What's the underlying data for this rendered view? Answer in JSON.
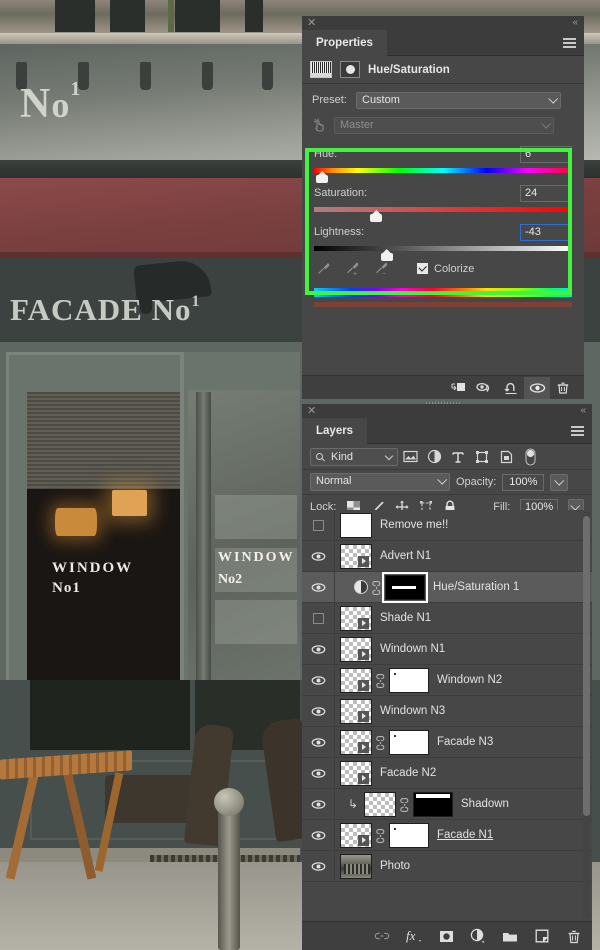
{
  "properties_panel": {
    "tab_label": "Properties",
    "close_icon": "close-icon",
    "collapse_icon": "double-chevron-left-icon",
    "menu_icon": "panel-menu-icon",
    "adjustment_title": "Hue/Saturation",
    "preset_label": "Preset:",
    "preset_value": "Custom",
    "channel_value": "Master",
    "hue": {
      "label": "Hue:",
      "value": "6",
      "thumb_pct": 3
    },
    "saturation": {
      "label": "Saturation:",
      "value": "24",
      "thumb_pct": 24
    },
    "lightness": {
      "label": "Lightness:",
      "value": "-43",
      "thumb_pct": 28
    },
    "colorize_label": "Colorize",
    "colorize_checked": true,
    "eyedroppers": [
      "eyedropper-icon",
      "eyedropper-plus-icon",
      "eyedropper-minus-icon"
    ],
    "footer_buttons": [
      "clip-to-layer-icon",
      "toggle-previous-state-icon",
      "reset-icon",
      "toggle-visibility-icon",
      "delete-icon"
    ],
    "highlight_color": "#43f43f"
  },
  "layers_panel": {
    "tab_label": "Layers",
    "close_icon": "close-icon",
    "collapse_icon": "double-chevron-left-icon",
    "menu_icon": "panel-menu-icon",
    "filter_kind_label": "Kind",
    "filter_icons": [
      "filter-pixel-icon",
      "filter-adjustment-icon",
      "filter-type-icon",
      "filter-shape-icon",
      "filter-smart-object-icon"
    ],
    "filter_toggle": "filter-enable-toggle",
    "blend_mode": "Normal",
    "opacity_label": "Opacity:",
    "opacity_value": "100%",
    "lock_label": "Lock:",
    "lock_icons": [
      "lock-transparency-icon",
      "lock-image-icon",
      "lock-position-icon",
      "lock-artboard-icon",
      "lock-all-icon"
    ],
    "fill_label": "Fill:",
    "fill_value": "100%",
    "rows": [
      {
        "name": "Remove me!!",
        "visible": false,
        "thumb": "white",
        "mask": null,
        "selected": false,
        "clipped": false,
        "underline": false,
        "adjustment": false
      },
      {
        "name": "Advert N1",
        "visible": true,
        "thumb": "transparent",
        "mask": null,
        "selected": false,
        "clipped": false,
        "underline": false,
        "adjustment": false
      },
      {
        "name": "Hue/Saturation 1",
        "visible": true,
        "thumb": "adjustment",
        "mask": "dark-selected",
        "selected": true,
        "clipped": false,
        "underline": false,
        "adjustment": true
      },
      {
        "name": "Shade N1",
        "visible": false,
        "thumb": "transparent",
        "mask": null,
        "selected": false,
        "clipped": false,
        "underline": false,
        "adjustment": false
      },
      {
        "name": "Windown N1",
        "visible": true,
        "thumb": "transparent",
        "mask": null,
        "selected": false,
        "clipped": false,
        "underline": false,
        "adjustment": false
      },
      {
        "name": "Windown N2",
        "visible": true,
        "thumb": "transparent",
        "mask": "white",
        "selected": false,
        "clipped": false,
        "underline": false,
        "adjustment": false
      },
      {
        "name": "Windown N3",
        "visible": true,
        "thumb": "transparent",
        "mask": null,
        "selected": false,
        "clipped": false,
        "underline": false,
        "adjustment": false
      },
      {
        "name": "Facade N3",
        "visible": true,
        "thumb": "transparent",
        "mask": "white",
        "selected": false,
        "clipped": false,
        "underline": false,
        "adjustment": false
      },
      {
        "name": "Facade N2",
        "visible": true,
        "thumb": "transparent",
        "mask": null,
        "selected": false,
        "clipped": false,
        "underline": false,
        "adjustment": false
      },
      {
        "name": "Shadown",
        "visible": true,
        "thumb": "transparent",
        "mask": "dark",
        "selected": false,
        "clipped": true,
        "underline": false,
        "adjustment": false
      },
      {
        "name": "Facade N1",
        "visible": true,
        "thumb": "transparent",
        "mask": "white",
        "selected": false,
        "clipped": false,
        "underline": true,
        "adjustment": false
      },
      {
        "name": "Photo",
        "visible": true,
        "thumb": "photo",
        "mask": null,
        "selected": false,
        "clipped": false,
        "underline": false,
        "adjustment": false
      }
    ],
    "footer_buttons": [
      "link-layers-icon",
      "layer-style-fx-icon",
      "add-layer-mask-icon",
      "new-adjustment-layer-icon",
      "new-group-icon",
      "new-layer-icon",
      "delete-layer-icon"
    ]
  },
  "background_photo": {
    "sign_top": "No1",
    "sign_top_sup": "1",
    "sign_facade": "FACADE No",
    "sign_facade_sup": "1",
    "window_label_1_line1": "WINDOW",
    "window_label_1_line2": "No1",
    "window_label_2_line1": "WINDOW",
    "window_label_2_line2": "No2"
  }
}
